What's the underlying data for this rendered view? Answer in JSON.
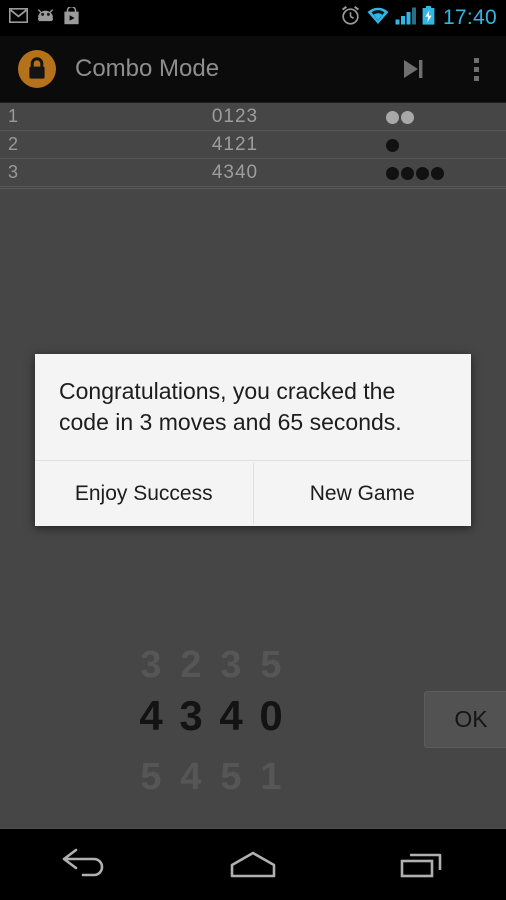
{
  "status_bar": {
    "left_icons": [
      "gmail-icon",
      "android-icon",
      "play-store-icon"
    ],
    "right_icons": [
      "alarm-icon",
      "wifi-icon",
      "signal-icon",
      "battery-charging-icon"
    ],
    "clock": "17:40",
    "accent_color": "#33b5e5"
  },
  "action_bar": {
    "app_icon": "lock-icon",
    "app_icon_color": "#b5721a",
    "title": "Combo Mode",
    "skip_icon": "skip-next-icon",
    "overflow_icon": "overflow-menu-icon"
  },
  "guess_list": {
    "rows": [
      {
        "index": "1",
        "code": "0123",
        "pegs": [
          "white",
          "white"
        ]
      },
      {
        "index": "2",
        "code": "4121",
        "pegs": [
          "black"
        ]
      },
      {
        "index": "3",
        "code": "4340",
        "pegs": [
          "black",
          "black",
          "black",
          "black"
        ]
      }
    ]
  },
  "number_picker": {
    "previous": [
      "3",
      "2",
      "3",
      "5"
    ],
    "current": [
      "4",
      "3",
      "4",
      "0"
    ],
    "next": [
      "5",
      "4",
      "5",
      "1"
    ],
    "ok_label": "OK"
  },
  "dialog": {
    "message": "Congratulations, you cracked the code in 3 moves and 65 seconds.",
    "buttons": [
      {
        "label": "Enjoy Success"
      },
      {
        "label": "New Game"
      }
    ]
  },
  "nav_bar": {
    "buttons": [
      "back-icon",
      "home-icon",
      "recents-icon"
    ]
  }
}
